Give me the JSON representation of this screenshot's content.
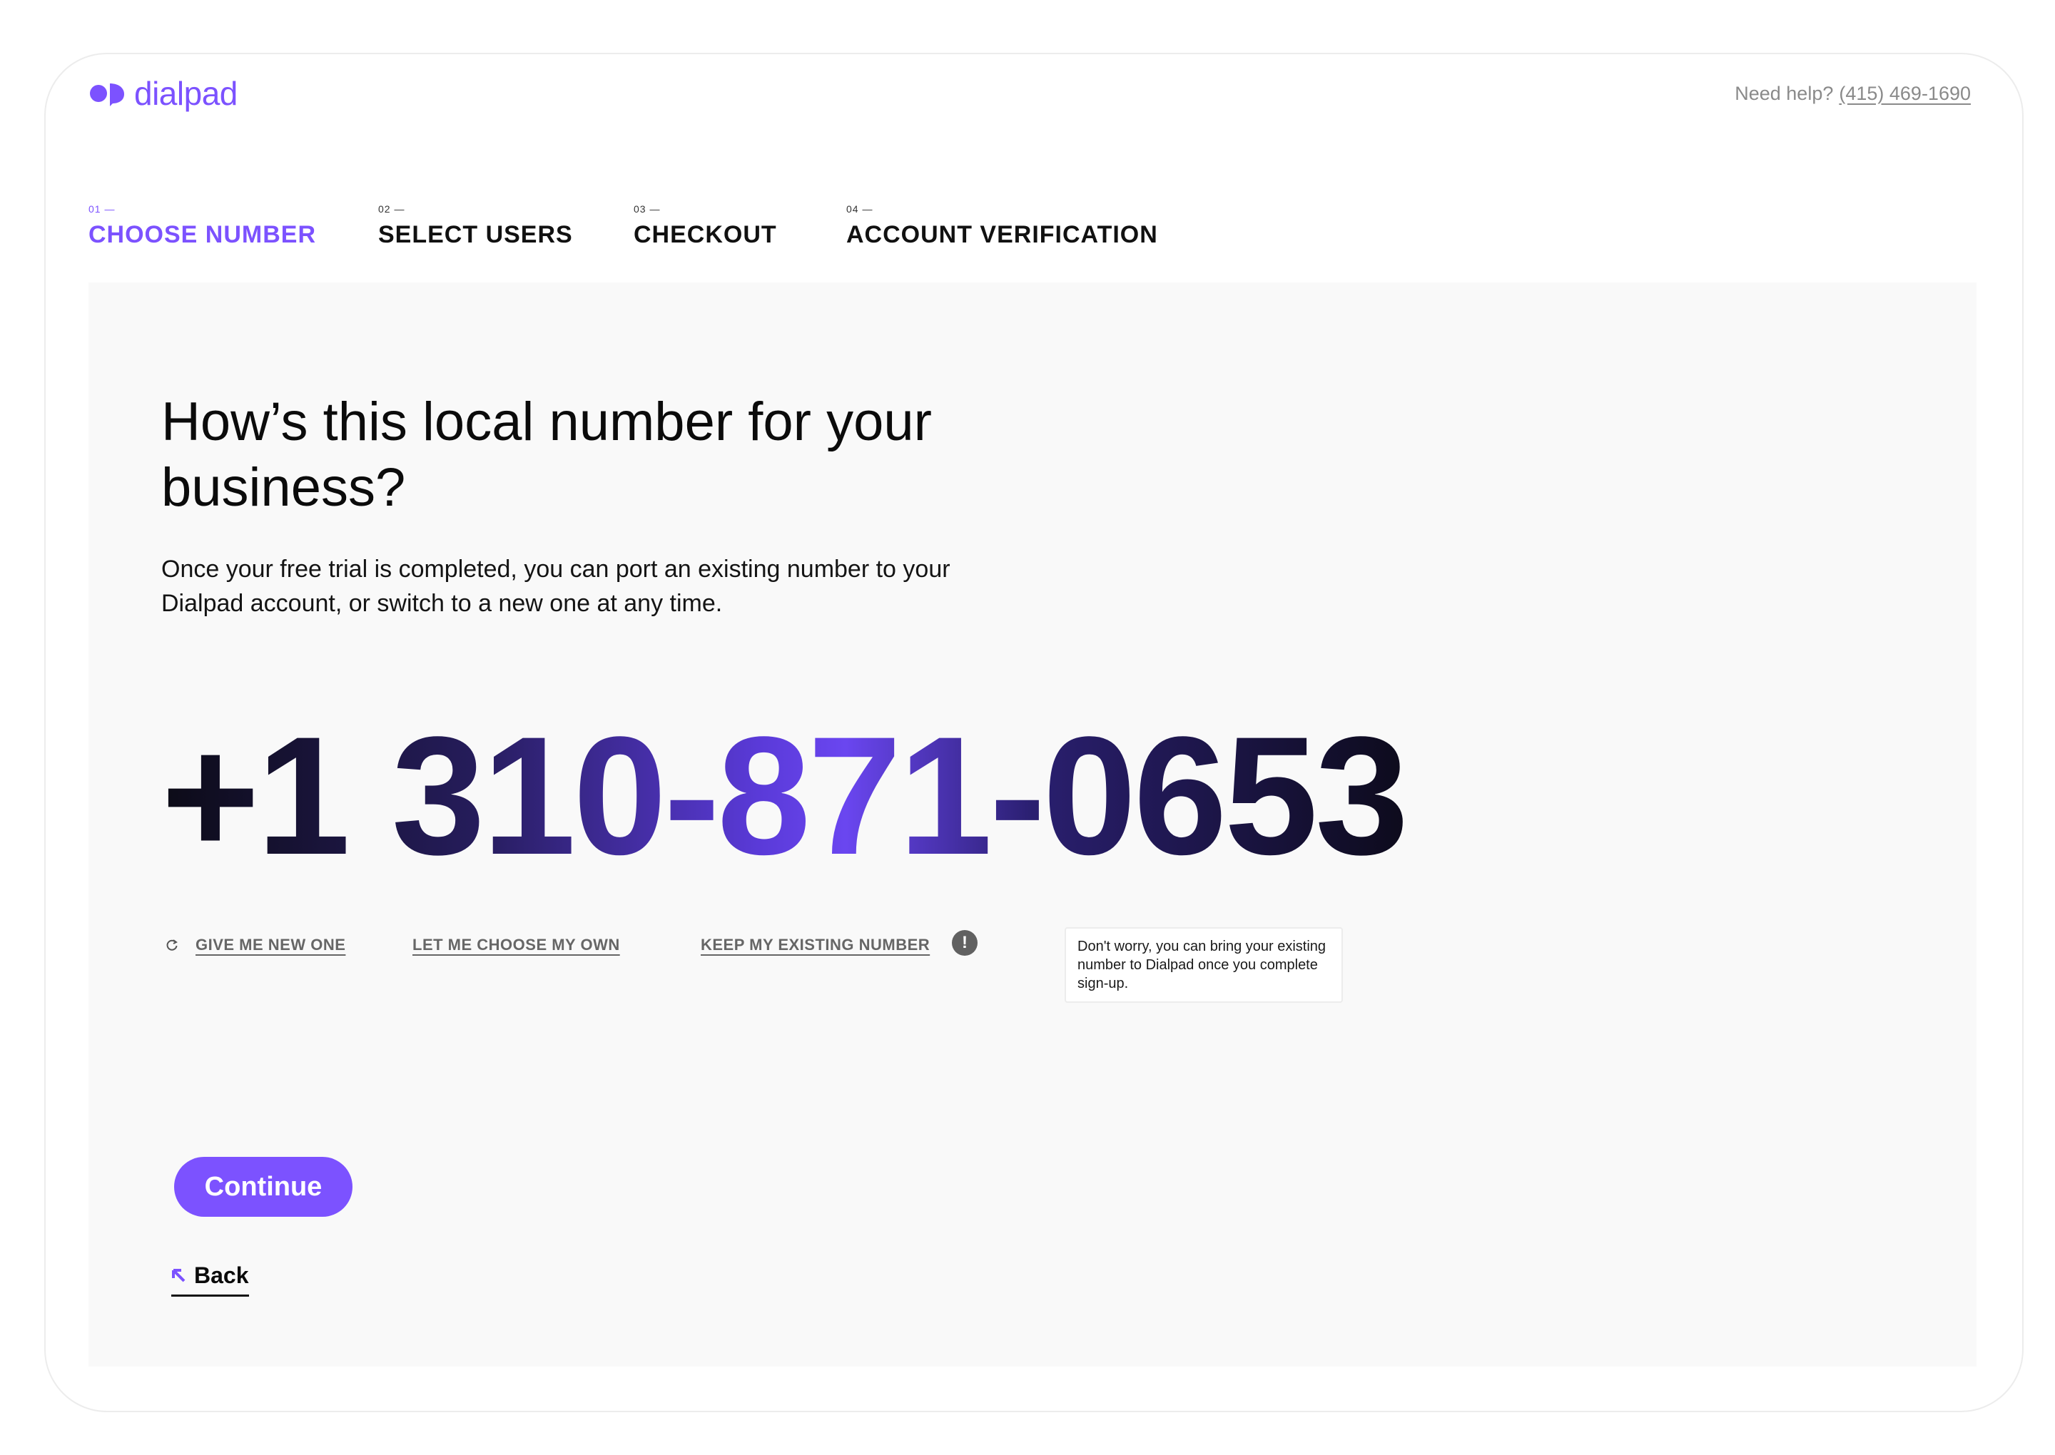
{
  "header": {
    "logo_text": "dialpad",
    "help_label": "Need help?",
    "help_phone": "(415) 469-1690"
  },
  "steps": [
    {
      "num": "01",
      "label": "CHOOSE NUMBER",
      "active": true
    },
    {
      "num": "02",
      "label": "SELECT USERS",
      "active": false
    },
    {
      "num": "03",
      "label": "CHECKOUT",
      "active": false
    },
    {
      "num": "04",
      "label": "ACCOUNT VERIFICATION",
      "active": false
    }
  ],
  "main": {
    "headline": "How’s this local number for your business?",
    "subtext": "Once your free trial is completed, you can port an existing number to your Dialpad account, or switch to a new one at any time.",
    "phone_number": "+1 310-871-0653",
    "options": {
      "new_one": "GIVE ME NEW ONE",
      "choose_own": "LET ME CHOOSE MY OWN",
      "keep_existing": "KEEP MY EXISTING NUMBER"
    },
    "tooltip": "Don't worry, you can bring your existing number to Dialpad once you complete sign-up.",
    "continue_label": "Continue",
    "back_label": "Back"
  },
  "colors": {
    "brand": "#7c52ff",
    "panel_bg": "#f9f9f9",
    "muted_text": "#8a8a8a"
  },
  "icons": [
    "dialpad-logo-icon",
    "refresh-icon",
    "info-icon",
    "arrow-up-left-icon"
  ]
}
